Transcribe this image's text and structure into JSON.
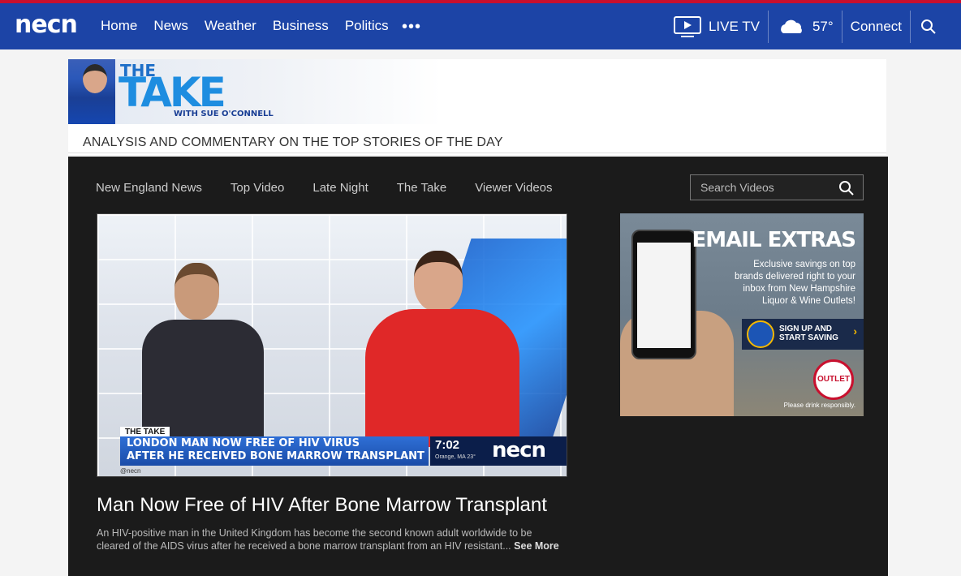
{
  "header": {
    "logo": "necn",
    "nav": [
      "Home",
      "News",
      "Weather",
      "Business",
      "Politics"
    ],
    "more": "•••",
    "live_tv": "LIVE TV",
    "temperature": "57°",
    "connect": "Connect"
  },
  "banner": {
    "the": "THE",
    "take": "TAKE",
    "with": "WITH SUE O'CONNELL",
    "tagline": "ANALYSIS AND COMMENTARY ON THE TOP STORIES OF THE DAY"
  },
  "video_nav": [
    "New England News",
    "Top Video",
    "Late Night",
    "The Take",
    "Viewer Videos"
  ],
  "search": {
    "placeholder": "Search Videos"
  },
  "player": {
    "lower_third_tag": "THE TAKE",
    "line1": "LONDON MAN NOW FREE OF HIV VIRUS",
    "line2": "AFTER HE RECEIVED BONE MARROW TRANSPLANT",
    "handle": "@necn",
    "time": "7:02",
    "location": "Orange, MA",
    "temp": "23°",
    "logo": "necn"
  },
  "video": {
    "title": "Man Now Free of HIV After Bone Marrow Transplant",
    "description": "An HIV-positive man in the United Kingdom has become the second known adult worldwide to be cleared of the AIDS virus after he received a bone marrow transplant from an HIV resistant...",
    "see_more": "See More"
  },
  "ad": {
    "title": "EMAIL EXTRAS",
    "text": "Exclusive savings on top brands delivered right to your inbox from New Hampshire Liquor & Wine Outlets!",
    "button": "SIGN UP AND START SAVING",
    "outlet": "OUTLET",
    "fine": "Please drink responsibly."
  },
  "colors": {
    "brand_blue": "#1c44a6",
    "accent_red": "#c8102e",
    "panel": "#1b1b1b"
  }
}
